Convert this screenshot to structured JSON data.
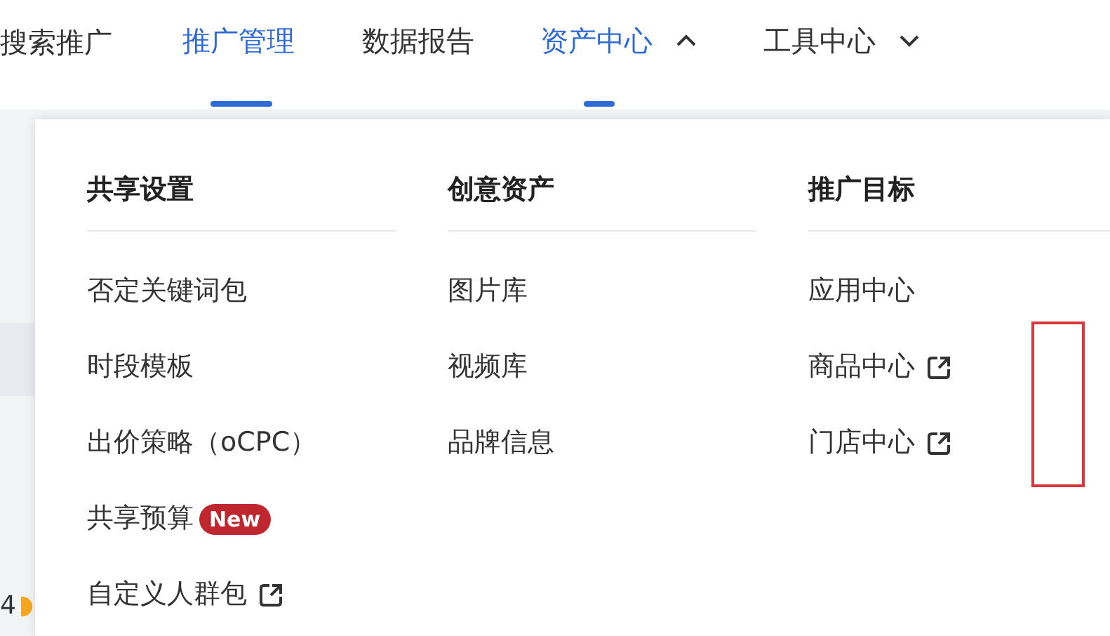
{
  "nav": {
    "title": "搜索推广",
    "items": [
      {
        "label": "推广管理",
        "selected": true,
        "has_menu": false
      },
      {
        "label": "数据报告",
        "selected": false,
        "has_menu": false
      },
      {
        "label": "资产中心",
        "selected": false,
        "expanded": true,
        "has_menu": true
      },
      {
        "label": "工具中心",
        "selected": false,
        "expanded": false,
        "has_menu": true
      }
    ]
  },
  "background": {
    "row_value": "4"
  },
  "dropdown": {
    "columns": [
      {
        "title": "共享设置",
        "items": [
          {
            "label": "否定关键词包",
            "kind": "plain"
          },
          {
            "label": "时段模板",
            "kind": "plain"
          },
          {
            "label": "出价策略（oCPC）",
            "kind": "plain"
          },
          {
            "label": "共享预算",
            "kind": "badge",
            "badge": "New"
          },
          {
            "label": "自定义人群包",
            "kind": "external"
          }
        ]
      },
      {
        "title": "创意资产",
        "items": [
          {
            "label": "图片库",
            "kind": "plain"
          },
          {
            "label": "视频库",
            "kind": "plain"
          },
          {
            "label": "品牌信息",
            "kind": "plain"
          }
        ]
      },
      {
        "title": "推广目标",
        "items": [
          {
            "label": "应用中心",
            "kind": "plain"
          },
          {
            "label": "商品中心",
            "kind": "external"
          },
          {
            "label": "门店中心",
            "kind": "external"
          }
        ]
      }
    ]
  }
}
